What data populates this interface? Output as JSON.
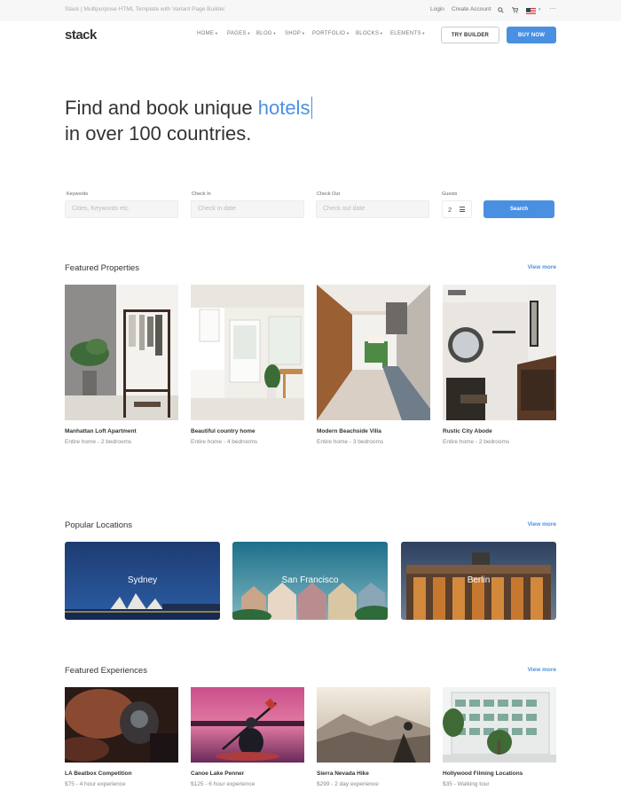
{
  "topbar": {
    "note": "Stack | Multipurpose HTML Template with Variant Page Builder",
    "login": "Login",
    "create_account": "Create Account",
    "more": "···"
  },
  "nav": {
    "logo": "stack",
    "items": [
      "HOME",
      "PAGES",
      "BLOG",
      "SHOP",
      "PORTFOLIO",
      "BLOCKS",
      "ELEMENTS"
    ],
    "try_builder": "TRY BUILDER",
    "buy_now": "BUY NOW"
  },
  "hero": {
    "line1_prefix": "Find and book unique ",
    "line1_highlight": "hotels",
    "line2": "in over 100 countries."
  },
  "search": {
    "keywords_label": "Keywords",
    "keywords_placeholder": "Cities, Keywords etc.",
    "checkin_label": "Check In",
    "checkin_placeholder": "Check in date",
    "checkout_label": "Check Out",
    "checkout_placeholder": "Check out date",
    "guests_label": "Guests",
    "guests_value": "2",
    "button": "Search"
  },
  "featured_properties": {
    "title": "Featured Properties",
    "view_more": "View more",
    "items": [
      {
        "title": "Manhattan Loft Apartment",
        "sub": "Entire home - 2 bedrooms"
      },
      {
        "title": "Beautiful country home",
        "sub": "Entire home - 4 bedrooms"
      },
      {
        "title": "Modern Beachside Villa",
        "sub": "Entire home - 3 bedrooms"
      },
      {
        "title": "Rustic City Abode",
        "sub": "Entire home - 2 bedrooms"
      }
    ]
  },
  "popular_locations": {
    "title": "Popular Locations",
    "view_more": "View more",
    "items": [
      "Sydney",
      "San Francisco",
      "Berlin"
    ]
  },
  "featured_experiences": {
    "title": "Featured Experiences",
    "view_more": "View more",
    "items": [
      {
        "title": "LA Beatbox Competition",
        "sub": "$75 - 4 hour experience"
      },
      {
        "title": "Canoe Lake Penner",
        "sub": "$125 - 6 hour experience"
      },
      {
        "title": "Sierra Nevada Hike",
        "sub": "$299 - 2 day experience"
      },
      {
        "title": "Hollywood Filming Locations",
        "sub": "$35 - Walking tour"
      }
    ]
  },
  "colors": {
    "accent": "#4a90e2",
    "text": "#333333",
    "muted": "#888888"
  }
}
